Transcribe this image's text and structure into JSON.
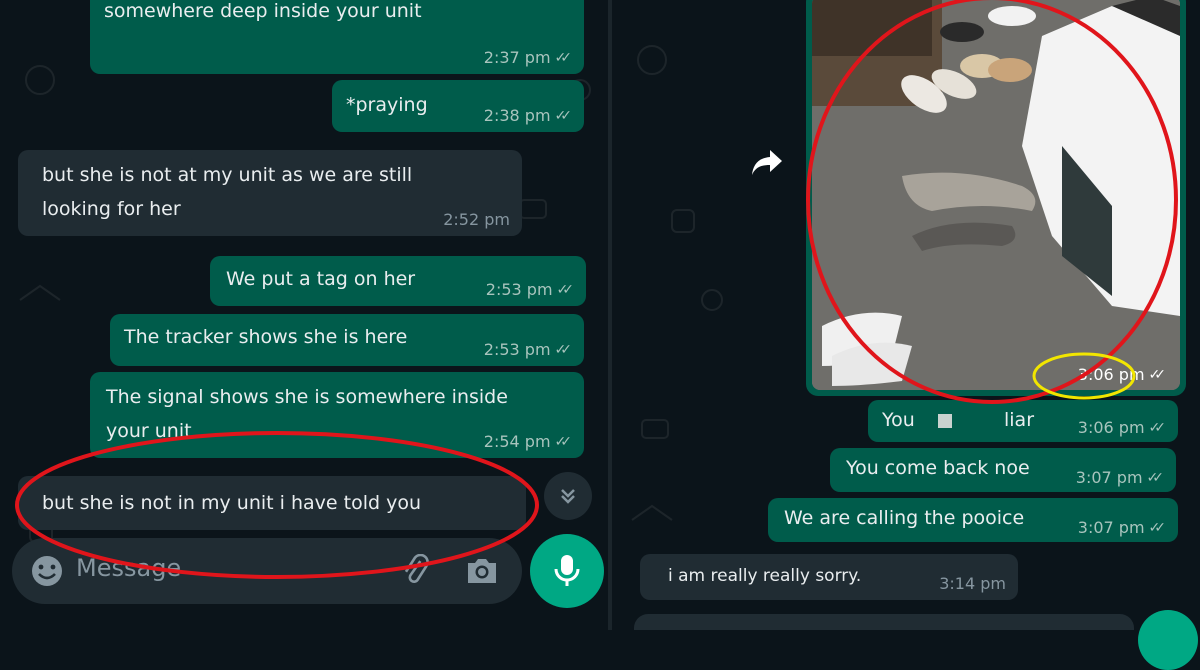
{
  "left_chat": {
    "messages": [
      {
        "text": "somewhere deep inside your unit",
        "time": "2:37 pm"
      },
      {
        "text": "*praying",
        "time": "2:38 pm"
      },
      {
        "line1": "but she is not at my unit as we are still",
        "line2": "looking for her",
        "time": "2:52 pm"
      },
      {
        "text": "We put a tag on her",
        "time": "2:53 pm"
      },
      {
        "text": "The tracker shows she is here",
        "time": "2:53 pm"
      },
      {
        "line1": "The signal shows she is somewhere inside",
        "line2": "your unit",
        "time": "2:54 pm"
      },
      {
        "text": "but she is not in my unit i have told you"
      }
    ],
    "input_placeholder": "Message"
  },
  "right_chat": {
    "media_time": "3:06 pm",
    "messages": [
      {
        "text": "You",
        "text_end": "liar",
        "time": "3:06 pm"
      },
      {
        "text": "You come back noe",
        "time": "3:07 pm"
      },
      {
        "text": "We are calling the pooice",
        "time": "3:07 pm"
      },
      {
        "text": "i am really really sorry.",
        "time": "3:14 pm"
      }
    ]
  },
  "colors": {
    "background": "#0b141a",
    "outgoing_bubble": "#005c4b",
    "incoming_bubble": "#202c33",
    "accent": "#00a884",
    "red_annotation": "#e0151b",
    "yellow_annotation": "#f2e600"
  },
  "icons": [
    "double-tick-icon",
    "emoji-icon",
    "attach-icon",
    "camera-icon",
    "mic-icon",
    "scroll-down-icon",
    "forward-icon"
  ]
}
